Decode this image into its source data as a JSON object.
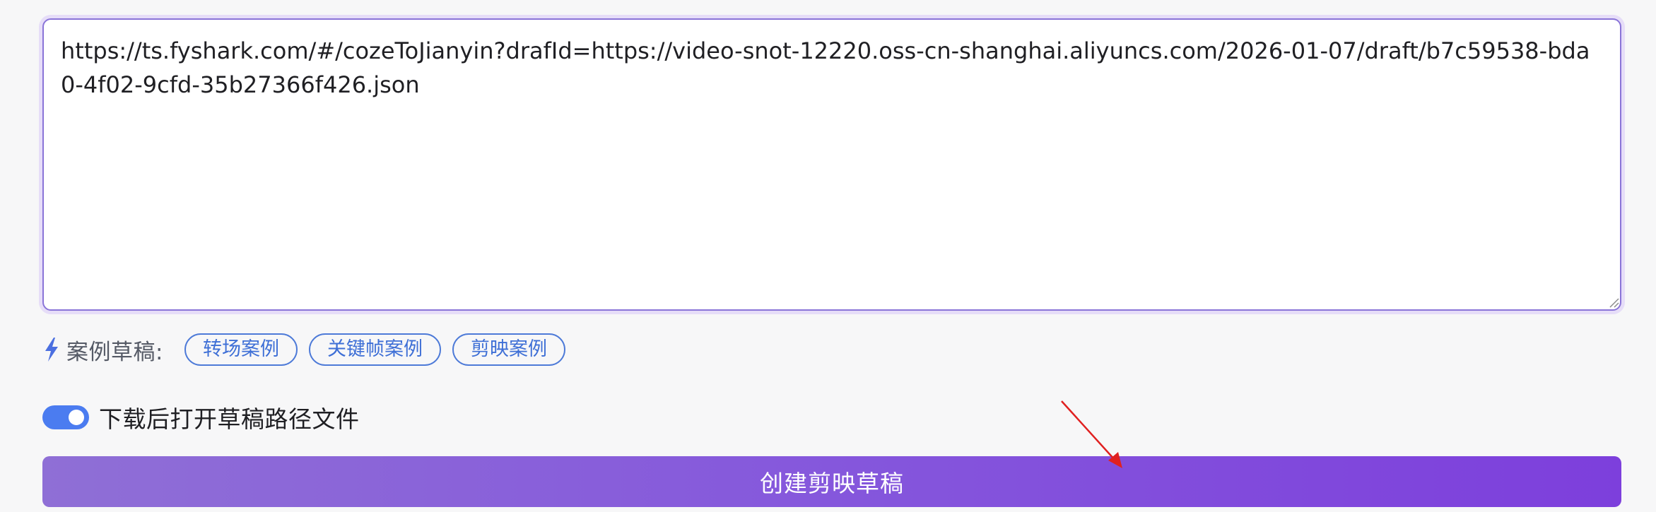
{
  "draft_input": {
    "value": "https://ts.fyshark.com/#/cozeToJianyin?drafId=https://video-snot-12220.oss-cn-shanghai.aliyuncs.com/2026-01-07/draft/b7c59538-bda0-4f02-9cfd-35b27366f426.json"
  },
  "examples": {
    "icon": "lightning-bolt-icon",
    "label": "案例草稿:",
    "chips": [
      {
        "label": "转场案例"
      },
      {
        "label": "关键帧案例"
      },
      {
        "label": "剪映案例"
      }
    ]
  },
  "open_after_download": {
    "label": "下载后打开草稿路径文件",
    "enabled": true
  },
  "create_button": {
    "label": "创建剪映草稿"
  },
  "colors": {
    "accent_purple": "#8557dc",
    "chip_blue": "#3e6fd6",
    "toggle_blue": "#4b7cf0",
    "annotation_red": "#e02020"
  }
}
